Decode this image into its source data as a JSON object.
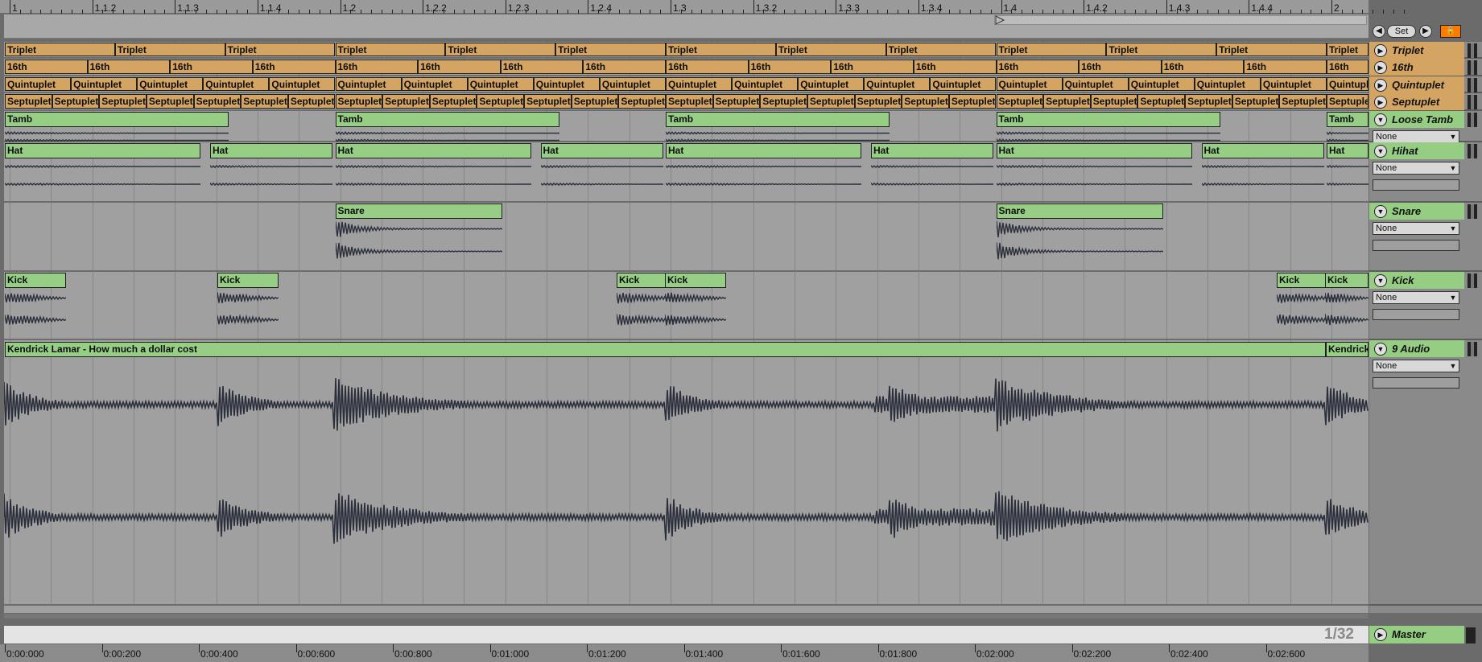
{
  "ruler": {
    "bars": [
      "1",
      "1.1.2",
      "1.1.3",
      "1.1.4",
      "1.2",
      "1.2.2",
      "1.2.3",
      "1.2.4",
      "1.3",
      "1.3.2",
      "1.3.3",
      "1.3.4",
      "1.4",
      "1.4.2",
      "1.4.3",
      "1.4.4",
      "2"
    ]
  },
  "time_ruler": {
    "labels": [
      "0:00:000",
      "0:00:200",
      "0:00:400",
      "0:00:600",
      "0:00:800",
      "0:01:000",
      "0:01:200",
      "0:01:400",
      "0:01:600",
      "0:01:800",
      "0:02:000",
      "0:02:200",
      "0:02:400",
      "0:02:600"
    ]
  },
  "transport": {
    "set_label": "Set",
    "prev_icon": "arrow-left-icon",
    "next_icon": "arrow-right-icon",
    "lock_icon": "lock-icon"
  },
  "zoom_label": "1/32",
  "colors": {
    "orange_clip": "#d4a463",
    "green_clip": "#96ce86",
    "waveform": "#2b2f3c",
    "lock_active": "#ff7a00",
    "arrange_bg": "#a0a0a0"
  },
  "tracks": [
    {
      "name": "Triplet",
      "color": "orange",
      "clip_name": "Triplet",
      "clips": 12,
      "has_selector": false
    },
    {
      "name": "16th",
      "color": "orange",
      "clip_name": "16th",
      "clips": 16,
      "has_selector": false
    },
    {
      "name": "Quintuplet",
      "color": "orange",
      "clip_name": "Quintuplet",
      "clips": 20,
      "has_selector": false
    },
    {
      "name": "Septuplet",
      "color": "orange",
      "clip_name": "Septuplet",
      "clips": 28,
      "has_selector": false
    },
    {
      "name": "Loose Tamb",
      "color": "green",
      "clip_name": "Tamb",
      "has_selector": true,
      "selector_value": "None",
      "has_field": false
    },
    {
      "name": "Hihat",
      "color": "green",
      "clip_name": "Hat",
      "has_selector": true,
      "selector_value": "None",
      "has_field": true
    },
    {
      "name": "Snare",
      "color": "green",
      "clip_name": "Snare",
      "has_selector": true,
      "selector_value": "None",
      "has_field": true
    },
    {
      "name": "Kick",
      "color": "green",
      "clip_name": "Kick",
      "has_selector": true,
      "selector_value": "None",
      "has_field": true
    },
    {
      "name": "9 Audio",
      "color": "green",
      "clip_name": "Kendrick Lamar - How much a dollar cost",
      "clip_name_2": "Kendrick",
      "has_selector": true,
      "selector_value": "None",
      "has_field": true
    }
  ],
  "master": {
    "name": "Master"
  }
}
